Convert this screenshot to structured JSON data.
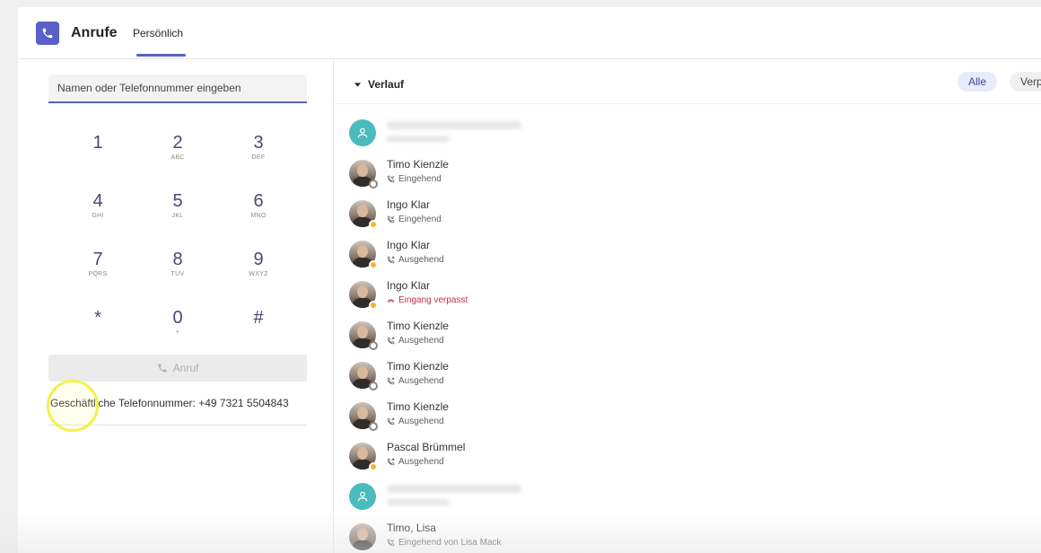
{
  "app": {
    "title": "Anrufe",
    "tab": "Persönlich",
    "accent": "#5b5fc7"
  },
  "dialer": {
    "search_placeholder": "Namen oder Telefonnummer eingeben",
    "keys": [
      {
        "digit": "1",
        "letters": ""
      },
      {
        "digit": "2",
        "letters": "ABC"
      },
      {
        "digit": "3",
        "letters": "DEF"
      },
      {
        "digit": "4",
        "letters": "GHI"
      },
      {
        "digit": "5",
        "letters": "JKL"
      },
      {
        "digit": "6",
        "letters": "MNO"
      },
      {
        "digit": "7",
        "letters": "PQRS"
      },
      {
        "digit": "8",
        "letters": "TUV"
      },
      {
        "digit": "9",
        "letters": "WXYZ"
      },
      {
        "digit": "*",
        "letters": ""
      },
      {
        "digit": "0",
        "letters": "+"
      },
      {
        "digit": "#",
        "letters": ""
      }
    ],
    "call_label": "Anruf",
    "business_phone": "Geschäftliche Telefonnummer: +49 7321 5504843"
  },
  "history": {
    "header": "Verlauf",
    "filters": [
      "Alle",
      "Verp"
    ],
    "items": [
      {
        "name": "",
        "status": "",
        "type": "",
        "avatar": "generic",
        "presence": ""
      },
      {
        "name": "Timo Kienzle",
        "status": "Eingehend",
        "type": "incoming",
        "avatar": "photo",
        "presence": "offline"
      },
      {
        "name": "Ingo Klar",
        "status": "Eingehend",
        "type": "incoming",
        "avatar": "photo",
        "presence": "away"
      },
      {
        "name": "Ingo Klar",
        "status": "Ausgehend",
        "type": "outgoing",
        "avatar": "photo",
        "presence": "away"
      },
      {
        "name": "Ingo Klar",
        "status": "Eingang verpasst",
        "type": "missed",
        "avatar": "photo",
        "presence": "away"
      },
      {
        "name": "Timo Kienzle",
        "status": "Ausgehend",
        "type": "outgoing",
        "avatar": "photo",
        "presence": "offline"
      },
      {
        "name": "Timo Kienzle",
        "status": "Ausgehend",
        "type": "outgoing",
        "avatar": "photo",
        "presence": "offline"
      },
      {
        "name": "Timo Kienzle",
        "status": "Ausgehend",
        "type": "outgoing",
        "avatar": "photo",
        "presence": "offline"
      },
      {
        "name": "Pascal Brümmel",
        "status": "Ausgehend",
        "type": "outgoing",
        "avatar": "photo",
        "presence": "away"
      },
      {
        "name": "",
        "status": "",
        "type": "",
        "avatar": "generic",
        "presence": ""
      },
      {
        "name": "Timo, Lisa",
        "status": "Eingehend von Lisa Mack",
        "type": "incoming",
        "avatar": "photo",
        "presence": ""
      }
    ]
  },
  "colors": {
    "missed": "#c4314b",
    "away": "#f8b32b",
    "generic_avatar": "#4bbbbd"
  }
}
